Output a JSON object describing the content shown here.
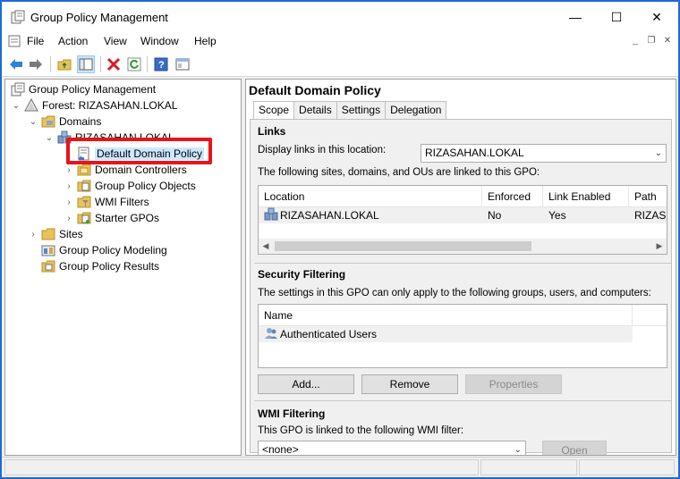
{
  "window": {
    "title": "Group Policy Management",
    "minimize": "—",
    "maximize": "☐",
    "close": "✕"
  },
  "menu": {
    "items": [
      "File",
      "Action",
      "View",
      "Window",
      "Help"
    ]
  },
  "tree": {
    "root": "Group Policy Management",
    "forest": "Forest: RIZASAHAN.LOKAL",
    "domains": "Domains",
    "domain": "RIZASAHAN.LOKAL",
    "children": [
      "Default Domain Policy",
      "Domain Controllers",
      "Group Policy Objects",
      "WMI Filters",
      "Starter GPOs"
    ],
    "sites": "Sites",
    "modeling": "Group Policy Modeling",
    "results": "Group Policy Results"
  },
  "detail": {
    "title": "Default Domain Policy",
    "tabs": [
      "Scope",
      "Details",
      "Settings",
      "Delegation"
    ],
    "links": {
      "title": "Links",
      "display_label": "Display links in this location:",
      "location_value": "RIZASAHAN.LOKAL",
      "description": "The following sites, domains, and OUs are linked to this GPO:",
      "columns": [
        "Location",
        "Enforced",
        "Link Enabled",
        "Path"
      ],
      "rows": [
        {
          "location": "RIZASAHAN.LOKAL",
          "enforced": "No",
          "link_enabled": "Yes",
          "path": "RIZAS..."
        }
      ]
    },
    "security": {
      "title": "Security Filtering",
      "description": "The settings in this GPO can only apply to the following groups, users, and computers:",
      "column": "Name",
      "rows": [
        "Authenticated Users"
      ],
      "buttons": {
        "add": "Add...",
        "remove": "Remove",
        "properties": "Properties"
      }
    },
    "wmi": {
      "title": "WMI Filtering",
      "description": "This GPO is linked to the following WMI filter:",
      "value": "<none>",
      "open": "Open"
    }
  },
  "colors": {
    "highlight": "#e8141b",
    "selection": "#cce8ff",
    "window_border": "#1e6ad4"
  }
}
